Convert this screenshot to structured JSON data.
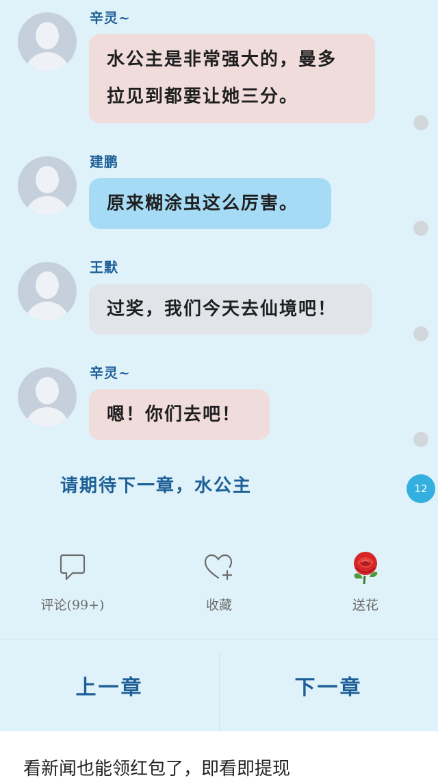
{
  "messages": [
    {
      "sender": "辛灵~",
      "text": "水公主是非常强大的，曼多拉见到都要让她三分。",
      "line1": "水公主是非常强大的，曼多",
      "line2": "拉见到都要让她三分。",
      "color": "pink"
    },
    {
      "sender": "建鹏",
      "text": "原来糊涂虫这么厉害。",
      "color": "blue"
    },
    {
      "sender": "王默",
      "text": "过奖，我们今天去仙境吧！",
      "color": "gray"
    },
    {
      "sender": "辛灵~",
      "text": "嗯！你们去吧！",
      "color": "pink"
    }
  ],
  "ending_text": "请期待下一章，水公主",
  "badge_count": "12",
  "actions": {
    "comment_label": "评论(99+)",
    "favorite_label": "收藏",
    "flower_label": "送花"
  },
  "chapters": {
    "prev_label": "上一章",
    "next_label": "下一章"
  },
  "ad_text": "看新闻也能领红包了，即看即提现",
  "colors": {
    "background": "#dff2fa",
    "accent": "#1d5f96",
    "badge": "#35aee0"
  },
  "icons": [
    "comment-icon",
    "heart-plus-icon",
    "rose-icon"
  ]
}
